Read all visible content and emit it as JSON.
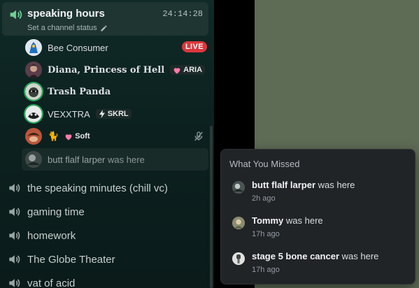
{
  "active_channel": {
    "name": "speaking hours",
    "timer": "24:14:28",
    "status": "Set a channel status"
  },
  "members": [
    {
      "name": "Bee Consumer",
      "badge": "LIVE",
      "avatar_color": "#1f6fbf",
      "avatar_letter": "B"
    },
    {
      "name": "Diana, Princess of Hell",
      "tag": "ARIA",
      "tag_icon": "heart-icon",
      "avatar_color": "#6d4b5a",
      "avatar_letter": "D"
    },
    {
      "name": "Trash Panda",
      "avatar_color": "#2d3b2f",
      "avatar_letter": "T"
    },
    {
      "name": "VEXXTRA",
      "tag": "SKRL",
      "tag_icon": "bolt-icon",
      "avatar_color": "#3a4442",
      "avatar_letter": "V"
    },
    {
      "name": "🐈",
      "tag": "Soft",
      "tag_icon": "heart-icon",
      "muted": true,
      "avatar_color": "#8a3a2a",
      "avatar_letter": ""
    },
    {
      "name": "butt flalf larper",
      "suffix": "was here",
      "avatar_color": "#3b4544",
      "avatar_letter": ""
    }
  ],
  "voice_channels": [
    {
      "name": "the speaking minutes (chill vc)"
    },
    {
      "name": "gaming time"
    },
    {
      "name": "homework"
    },
    {
      "name": "The Globe Theater"
    },
    {
      "name": "vat of acid"
    }
  ],
  "popup": {
    "title": "What You Missed",
    "events": [
      {
        "user": "butt flalf larper",
        "text": "was here",
        "time": "2h ago",
        "avatar_color": "#3b4544"
      },
      {
        "user": "Tommy",
        "text": "was here",
        "time": "17h ago",
        "avatar_color": "#6b6f5a"
      },
      {
        "user": "stage 5 bone cancer",
        "text": "was here",
        "time": "17h ago",
        "avatar_color": "#4a4f4c"
      }
    ]
  },
  "colors": {
    "sidebar_bg": "#0f2a27",
    "live_red": "#da373c",
    "speaking_green": "#23a559",
    "right_pane": "#5e6b55",
    "popup_bg": "#212427"
  }
}
